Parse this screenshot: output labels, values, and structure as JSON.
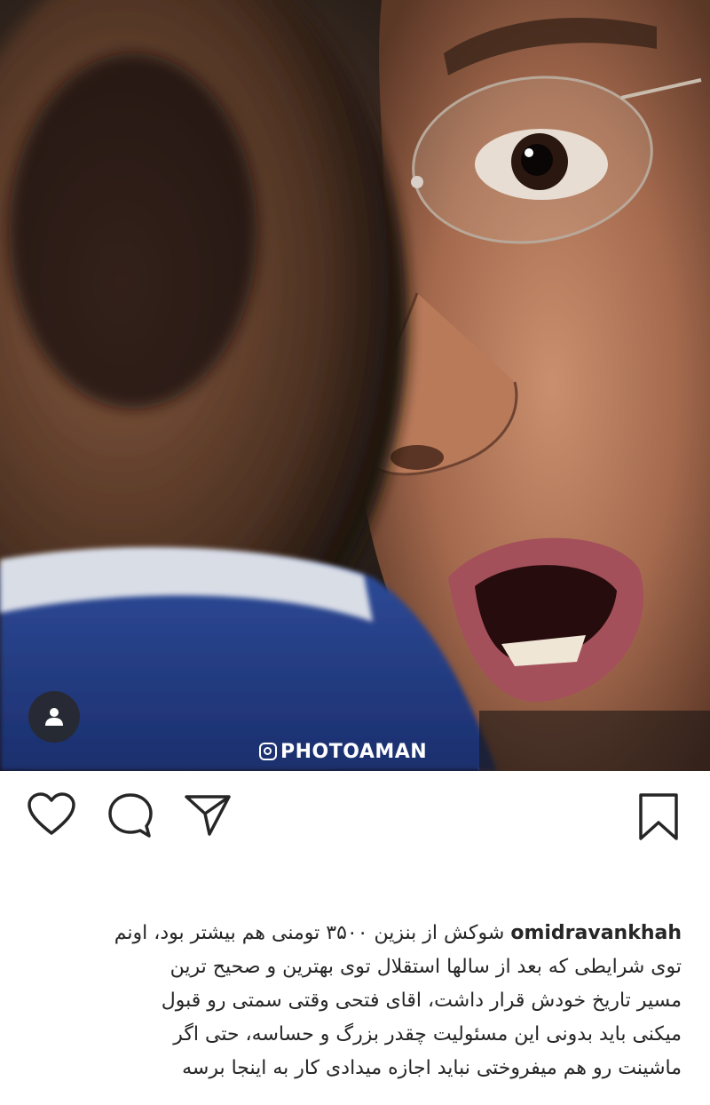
{
  "post": {
    "image_description": "",
    "watermark": "PHOTOAMAN",
    "tag_icon": "person-icon"
  },
  "actions": {
    "like_icon": "heart-icon",
    "comment_icon": "comment-icon",
    "share_icon": "send-icon",
    "save_icon": "bookmark-icon"
  },
  "caption": {
    "username": "omidravankhah",
    "line1": "شوکش از بنزین ۳۵۰۰ تومنی هم بیشتر بود، اونم",
    "line2": "توی شرایطی که بعد از سالها استقلال توی بهترین و صحیح ترین",
    "line3": "مسیر تاریخ خودش قرار داشت، اقای فتحی وقتی سمتی رو قبول",
    "line4": "میکنی باید بدونی این مسئولیت چقدر بزرگ و حساسه، حتی اگر",
    "line5": "ماشینت رو هم میفروختی نباید اجازه میدادی کار به اینجا برسه"
  }
}
